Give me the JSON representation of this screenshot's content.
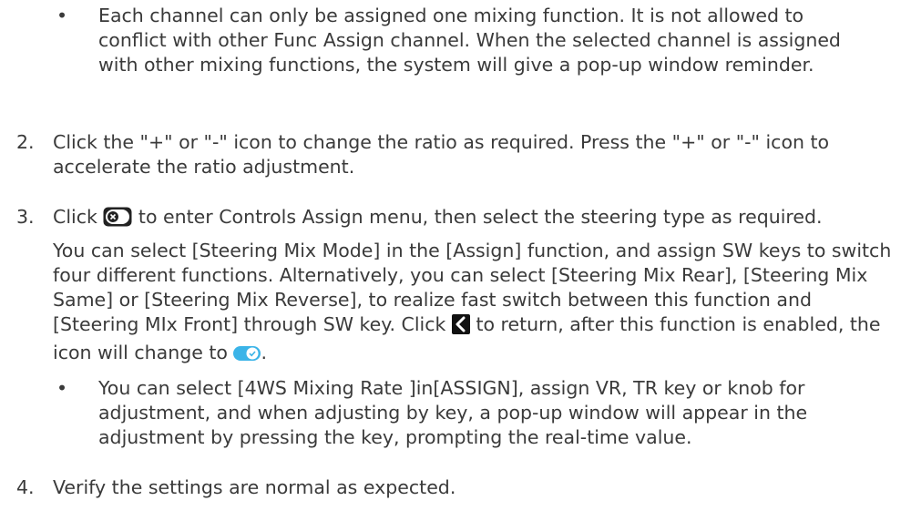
{
  "bullets": {
    "b1": "Each channel can only be assigned one mixing function. It is not allowed to conflict with other Func Assign channel. When the selected channel is assigned with other mixing functions, the system will give a pop-up window reminder.",
    "b2": "You can select [4WS Mixing Rate ]in[ASSIGN], assign VR, TR key or knob for adjustment, and when adjusting by key, a pop-up window will appear in the adjustment by pressing the key, prompting the real-time value."
  },
  "bullet_symbol": "•",
  "steps": {
    "s2": {
      "num": "2.",
      "text": "Click the \"+\" or \"-\" icon to change the ratio as required. Press the \"+\" or \"-\" icon to accelerate the ratio adjustment."
    },
    "s3": {
      "num": "3.",
      "text_a": "Click",
      "text_b": "to enter Controls Assign menu, then select the steering type as required.",
      "para2_a": "You can select [Steering Mix Mode] in the [Assign] function, and assign SW keys to switch four different functions. Alternatively, you can select [Steering Mix Rear], [Steering Mix Same] or [Steering Mix  Reverse], to realize fast switch between this function and [Steering MIx Front] through SW key.  Click",
      "para2_b": "to return, after this function is enabled, the icon will change to",
      "para2_c": "."
    },
    "s4": {
      "num": "4.",
      "text": "Verify the settings are normal as expected."
    }
  },
  "icons": {
    "toggle_off": "toggle-off-icon",
    "back": "chevron-left-icon",
    "toggle_on": "toggle-on-icon"
  },
  "colors": {
    "text": "#3a3a3a",
    "toggle_on": "#3bb4e8",
    "toggle_off": "#222222"
  }
}
